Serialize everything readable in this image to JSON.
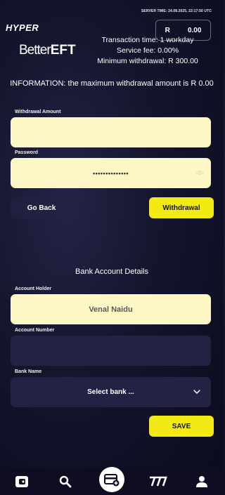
{
  "header": {
    "server_time": "SERVER TIME: 24.08.2025, 22:17:50 UTC",
    "logo": "HYPER",
    "balance_currency": "R",
    "balance_amount": "0.00"
  },
  "provider": {
    "brand_prefix": "Better",
    "brand_suffix": "EFT",
    "transaction_time": "Transaction time: 1 workday",
    "service_fee": "Service fee: 0.00%",
    "minimum_withdrawal": "Minimum withdrawal: R 300.00"
  },
  "notice": "INFORMATION: the maximum withdrawal amount is R 0.00",
  "withdrawal_form": {
    "amount_label": "Withdrawal Amount",
    "amount_value": "",
    "password_label": "Password",
    "password_value": "••••••••••••••",
    "go_back_label": "Go Back",
    "withdrawal_label": "Withdrawal"
  },
  "bank_details": {
    "title": "Bank Account Details",
    "holder_label": "Account Holder",
    "holder_value": "Venal Naidu",
    "number_label": "Account Number",
    "number_value": "",
    "bank_label": "Bank Name",
    "bank_select_value": "Select bank ...",
    "save_label": "SAVE"
  },
  "bottom_nav": {
    "items": [
      "wallet-icon",
      "search-icon",
      "cashier-icon",
      "slots-icon",
      "profile-icon"
    ]
  },
  "colors": {
    "accent_yellow": "#f3e914",
    "field_light": "#fdf7c6",
    "field_dark": "#232244",
    "background": "#14142c"
  }
}
